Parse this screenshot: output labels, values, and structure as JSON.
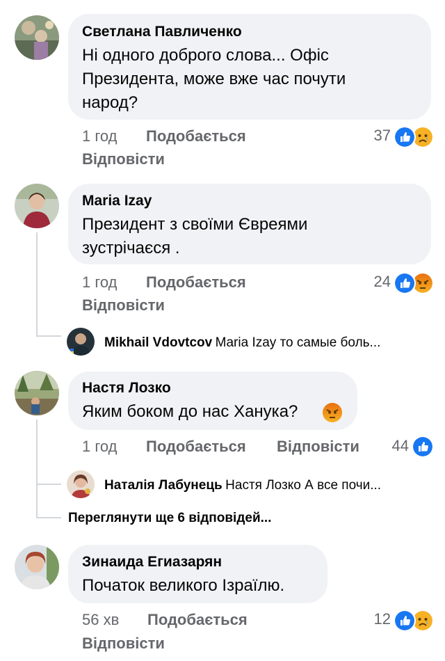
{
  "comments": [
    {
      "author": "Светлана Павличенко",
      "text": "Ні одного доброго слова... Офіс Президента, може вже час почути народ?",
      "time": "1 год",
      "like": "Подобається",
      "reply": "Відповісти",
      "count": "37",
      "reactions": [
        "like-icon",
        "sad-icon"
      ]
    },
    {
      "author": "Maria Izay",
      "text": "Президент з своїми Євреями зустрічаєся .",
      "time": "1 год",
      "like": "Подобається",
      "reply": "Відповісти",
      "count": "24",
      "reactions": [
        "like-icon",
        "angry-icon"
      ],
      "replies": [
        {
          "author": "Mikhail Vdovtcov",
          "text": "Maria Izay то самые боль..."
        }
      ]
    },
    {
      "author": "Настя Лозко",
      "text": "Яким боком до нас Ханука?",
      "time": "1 год",
      "like": "Подобається",
      "reply": "Відповісти",
      "count": "44",
      "reactions": [
        "like-icon"
      ],
      "replies": [
        {
          "author": "Наталія Лабунець",
          "text": "Настя Лозко А все почи..."
        }
      ],
      "more_replies": "Переглянути ще 6 відповідей..."
    },
    {
      "author": "Зинаида Егиазарян",
      "text": "Початок великого Ізраїлю.",
      "time": "56 хв",
      "like": "Подобається",
      "reply": "Відповісти",
      "count": "12",
      "reactions": [
        "like-icon",
        "sad-icon"
      ]
    }
  ],
  "colors": {
    "like_blue": "#1877f2",
    "bubble_bg": "#f0f2f5",
    "meta_gray": "#65676b",
    "emoji_yellow": "#f7b125",
    "angry_orange": "#e9710f"
  }
}
